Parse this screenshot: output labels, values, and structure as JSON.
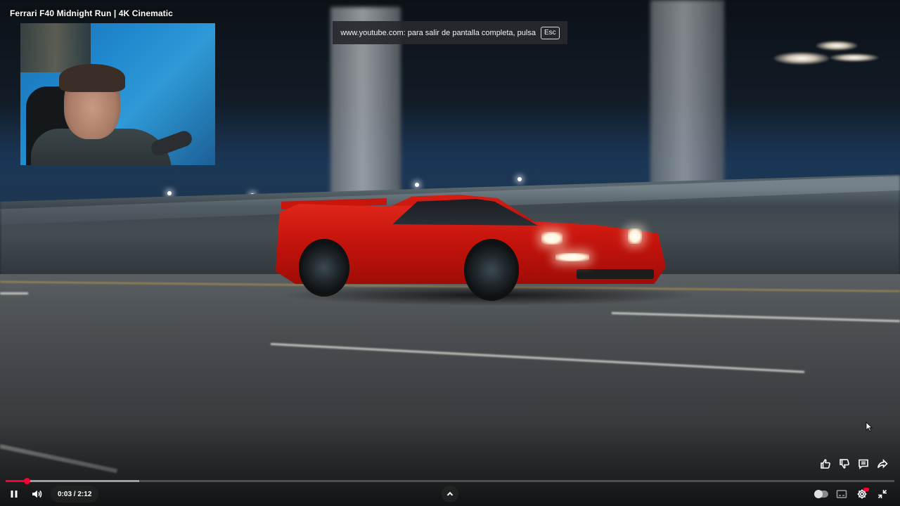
{
  "video": {
    "title": "Ferrari F40 Midnight Run | 4K Cinematic"
  },
  "fullscreen_notice": {
    "text": "www.youtube.com: para salir de pantalla completa, pulsa",
    "key": "Esc"
  },
  "player": {
    "current_time": "0:03",
    "separator": " / ",
    "duration": "2:12",
    "played_fraction": 0.024,
    "buffered_fraction": 0.15,
    "accent_color": "#ff0033"
  },
  "icons": {
    "play_pause": "pause-icon",
    "volume": "volume-icon",
    "chapters": "chevron-up-icon",
    "autoplay": "autoplay-toggle-icon",
    "subtitles": "subtitles-icon",
    "settings": "gear-icon",
    "exit_fullscreen": "exit-fullscreen-icon",
    "like": "thumbs-up-icon",
    "dislike": "thumbs-down-icon",
    "comments": "comment-icon",
    "share": "share-icon"
  }
}
